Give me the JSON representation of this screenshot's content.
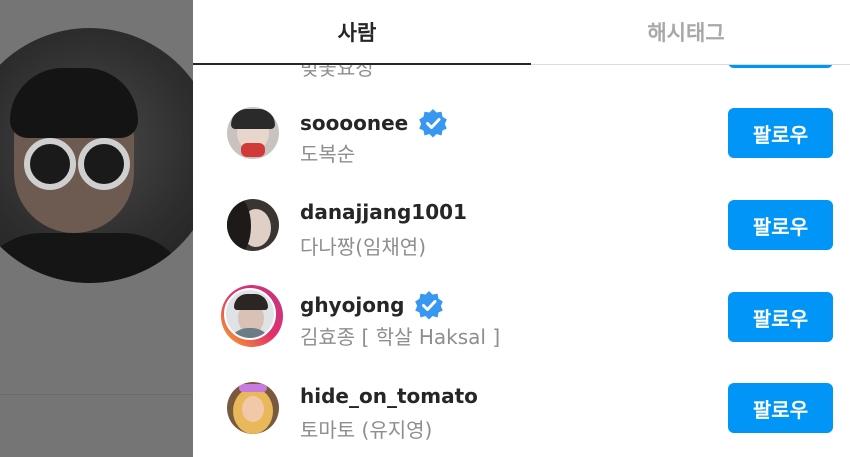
{
  "tabs": {
    "people": "사람",
    "hashtags": "해시태그"
  },
  "partial_row": {
    "fullname": "벚꽃요정"
  },
  "results": [
    {
      "username": "soooonee",
      "fullname": "도복순",
      "verified": true,
      "follow_label": "팔로우",
      "avatar": "avatar-photo"
    },
    {
      "username": "danajjang1001",
      "fullname": "다나짱(임채연)",
      "verified": false,
      "follow_label": "팔로우",
      "avatar": "avatar-photo"
    },
    {
      "username": "ghyojong",
      "fullname": "김효종 [ 학살 Haksal ]",
      "verified": true,
      "follow_label": "팔로우",
      "avatar": "avatar-photo-story-ring"
    },
    {
      "username": "hide_on_tomato",
      "fullname": "토마토 (유지영)",
      "verified": false,
      "follow_label": "팔로우",
      "avatar": "avatar-photo"
    }
  ],
  "colors": {
    "accent": "#0095f6",
    "verified": "#3897f0",
    "primary_text": "#262626",
    "secondary_text": "#8e8e8e"
  }
}
